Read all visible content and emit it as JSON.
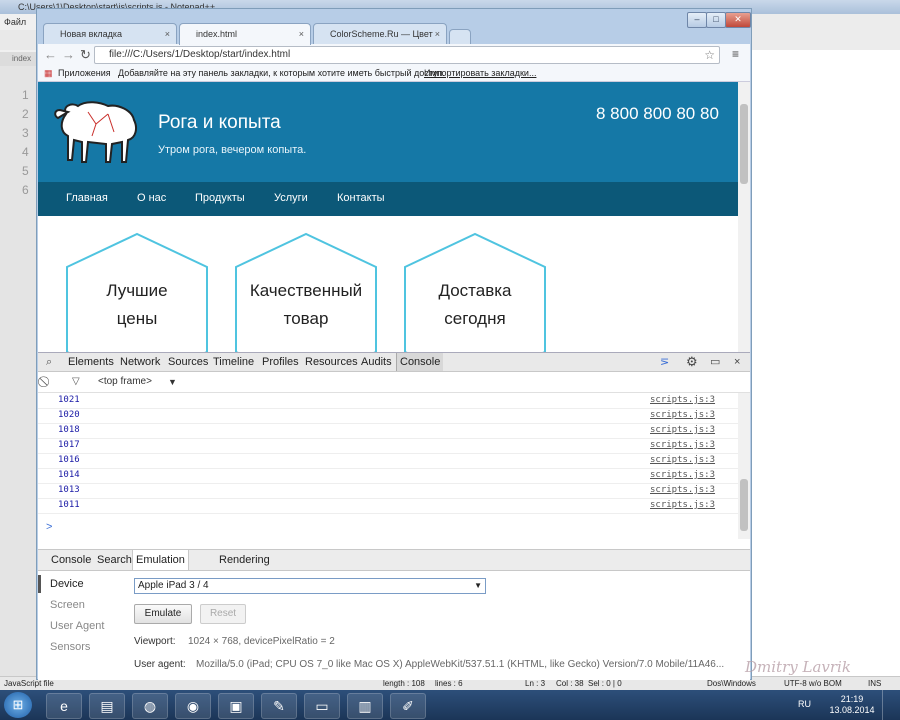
{
  "notepad": {
    "title": "C:\\Users\\1\\Desktop\\start\\js\\scripts.js - Notepad++",
    "menu_first": "Файл",
    "tab_label": "index",
    "line_numbers": [
      "1",
      "2",
      "3",
      "4",
      "5",
      "6"
    ],
    "status": {
      "type": "JavaScript file",
      "length": "length : 108",
      "lines": "lines : 6",
      "ln": "Ln : 3",
      "col": "Col : 38",
      "sel": "Sel : 0 | 0",
      "eol": "Dos\\Windows",
      "encoding": "UTF-8 w/o BOM",
      "ins": "INS"
    }
  },
  "browser": {
    "tabs": [
      {
        "label": "Новая вкладка"
      },
      {
        "label": "index.html"
      },
      {
        "label": "ColorScheme.Ru — Цвет"
      }
    ],
    "window_buttons": {
      "minimize": "–",
      "maximize": "□",
      "close": "✕"
    },
    "url": "file:///C:/Users/1/Desktop/start/index.html",
    "bookmarks": {
      "apps": "Приложения",
      "hint": "Добавляйте на эту панель закладки, к которым хотите иметь быстрый доступ.",
      "import": "Импортировать закладки..."
    }
  },
  "site": {
    "title": "Рога и копыта",
    "subtitle": "Утром рога, вечером копыта.",
    "phone": "8 800 800 80 80",
    "nav": [
      "Главная",
      "О нас",
      "Продукты",
      "Услуги",
      "Контакты"
    ],
    "features": [
      {
        "line1": "Лучшие",
        "line2": "цены"
      },
      {
        "line1": "Качественный",
        "line2": "товар"
      },
      {
        "line1": "Доставка",
        "line2": "сегодня"
      }
    ],
    "colors": {
      "header": "#1578a6",
      "nav": "#0c5878",
      "hex_border": "#4fc4e0"
    }
  },
  "devtools": {
    "tabs": [
      "Elements",
      "Network",
      "Sources",
      "Timeline",
      "Profiles",
      "Resources",
      "Audits",
      "Console"
    ],
    "active_tab": "Console",
    "frame": "<top frame>",
    "console_rows": [
      {
        "value": "1021",
        "source": "scripts.js:3"
      },
      {
        "value": "1020",
        "source": "scripts.js:3"
      },
      {
        "value": "1018",
        "source": "scripts.js:3"
      },
      {
        "value": "1017",
        "source": "scripts.js:3"
      },
      {
        "value": "1016",
        "source": "scripts.js:3"
      },
      {
        "value": "1014",
        "source": "scripts.js:3"
      },
      {
        "value": "1013",
        "source": "scripts.js:3"
      },
      {
        "value": "1011",
        "source": "scripts.js:3"
      }
    ],
    "prompt": ">",
    "drawer_tabs": [
      "Console",
      "Search",
      "Emulation",
      "Rendering"
    ],
    "drawer_active": "Emulation",
    "emulation": {
      "sidebar": [
        "Device",
        "Screen",
        "User Agent",
        "Sensors"
      ],
      "device": "Apple iPad 3 / 4",
      "emulate_btn": "Emulate",
      "reset_btn": "Reset",
      "viewport_label": "Viewport:",
      "viewport_value": "1024 × 768, devicePixelRatio = 2",
      "ua_label": "User agent:",
      "ua_value": "Mozilla/5.0 (iPad; CPU OS 7_0 like Mac OS X) AppleWebKit/537.51.1 (KHTML, like Gecko) Version/7.0 Mobile/11A46..."
    }
  },
  "taskbar": {
    "lang": "RU",
    "time": "21:19",
    "date": "13.08.2014"
  },
  "watermark": "Dmitry Lavrik"
}
